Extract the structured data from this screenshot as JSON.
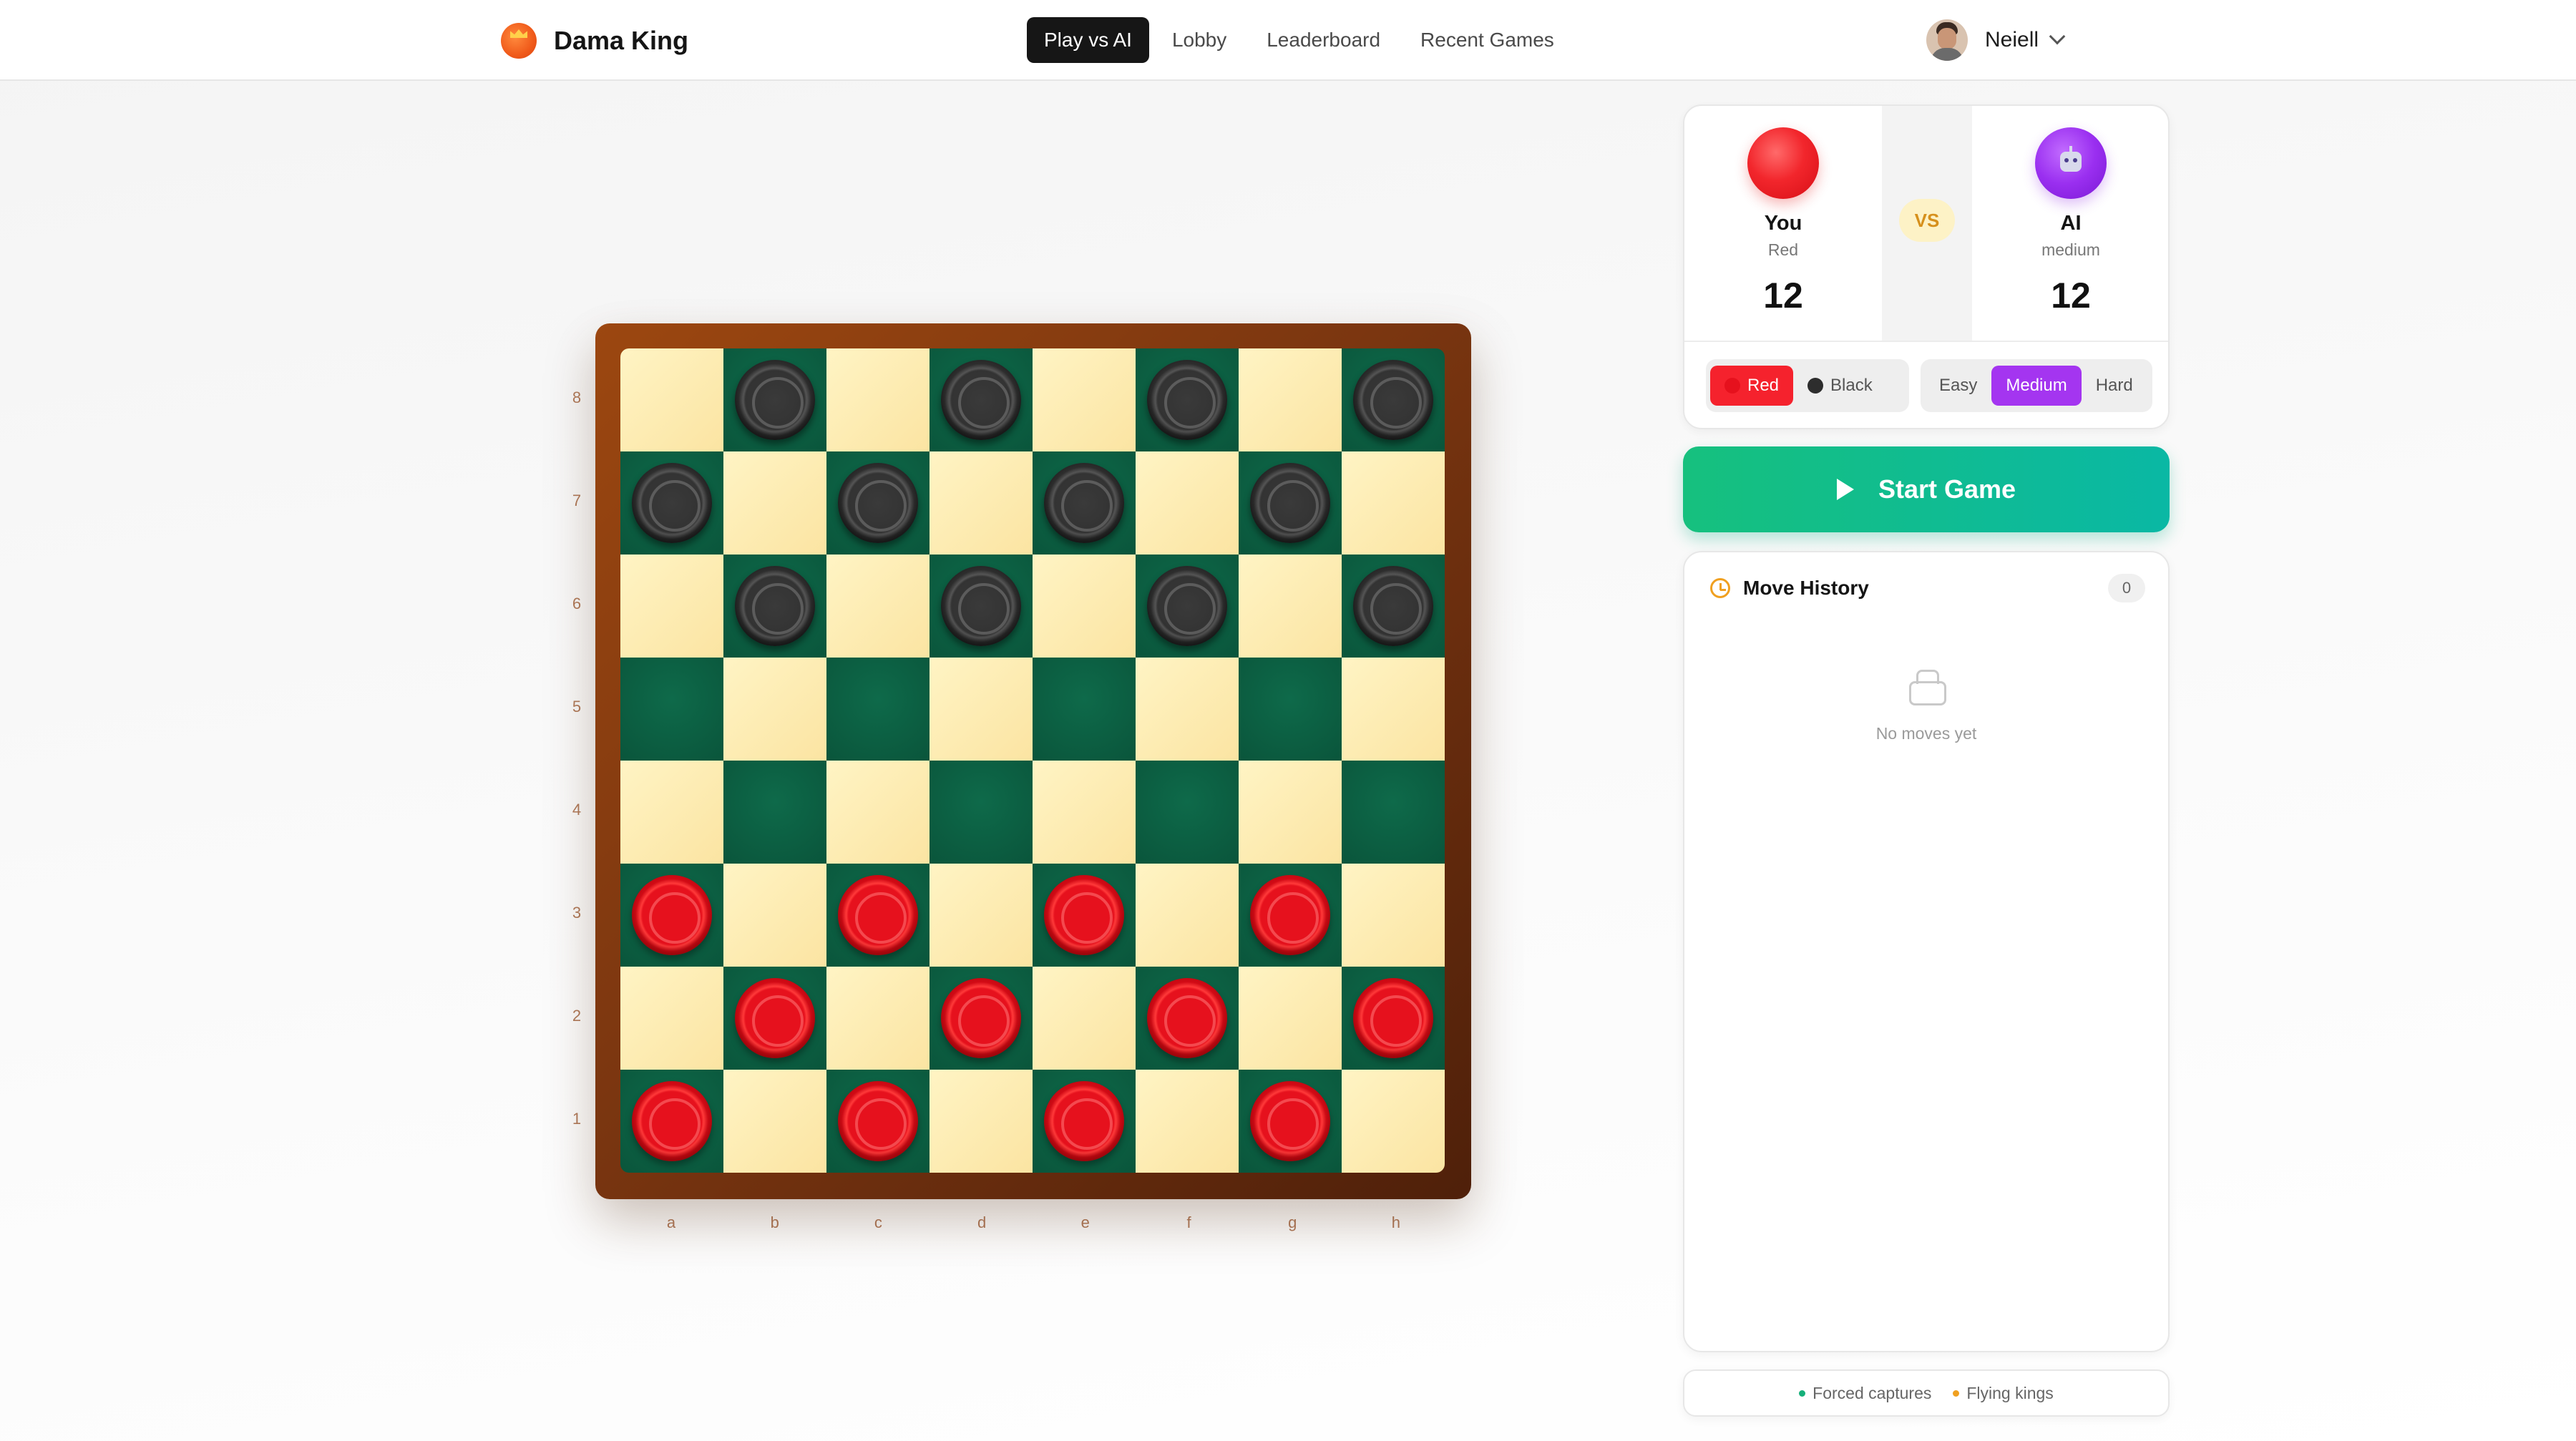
{
  "header": {
    "brand": "Dama King",
    "nav": [
      "Play vs AI",
      "Lobby",
      "Leaderboard",
      "Recent Games"
    ],
    "active_nav": "Play vs AI",
    "user_name": "Neiell"
  },
  "board": {
    "ranks": [
      "8",
      "7",
      "6",
      "5",
      "4",
      "3",
      "2",
      "1"
    ],
    "files": [
      "a",
      "b",
      "c",
      "d",
      "e",
      "f",
      "g",
      "h"
    ],
    "rows": [
      "-b-b-b-b",
      "b-b-b-b-",
      "-b-b-b-b",
      "--------",
      "--------",
      "r-r-r-r-",
      "-r-r-r-r",
      "r-r-r-r-"
    ],
    "colors": {
      "light": "#fbe9b0",
      "dark": "#0b5c40",
      "frame": "#7b3610"
    }
  },
  "score": {
    "player": {
      "name": "You",
      "side": "Red",
      "count": "12"
    },
    "vs": "VS",
    "ai": {
      "name": "AI",
      "level": "medium",
      "count": "12"
    }
  },
  "controls": {
    "colors": {
      "red": "Red",
      "black": "Black",
      "selected": "Red"
    },
    "difficulty": {
      "easy": "Easy",
      "medium": "Medium",
      "hard": "Hard",
      "selected": "Medium"
    }
  },
  "start_button": "Start Game",
  "history": {
    "title": "Move History",
    "count": "0",
    "empty": "No moves yet"
  },
  "rules": {
    "forced": "Forced captures",
    "flying": "Flying kings",
    "forced_color": "#16b07a",
    "flying_color": "#f0a020"
  },
  "accent_colors": {
    "red": "#f5222d",
    "purple": "#a435f0",
    "teal": "#0ab8a4"
  }
}
